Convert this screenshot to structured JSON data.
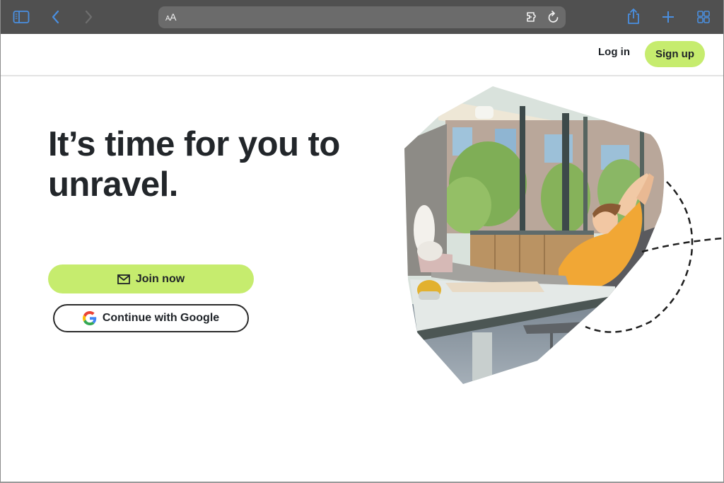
{
  "browser": {
    "address_bar_text_small": "A",
    "address_bar_text_large": "A",
    "icons": {
      "sidebar": "sidebar-icon",
      "back": "chevron-left-icon",
      "forward": "chevron-right-icon",
      "extension": "extension-icon",
      "reload": "reload-icon",
      "share": "share-icon",
      "new_tab": "plus-icon",
      "tabs": "tab-overview-icon"
    },
    "accent_color": "#4a8fe0"
  },
  "header": {
    "login_label": "Log in",
    "signup_label": "Sign up"
  },
  "hero": {
    "headline_line1": "It’s time for you to",
    "headline_line2": "unravel.",
    "join_label": "Join now",
    "google_label": "Continue with Google",
    "image_alt": "Woman stretching in office chair with feet on desk",
    "brand_color": "#c6ec6e"
  }
}
